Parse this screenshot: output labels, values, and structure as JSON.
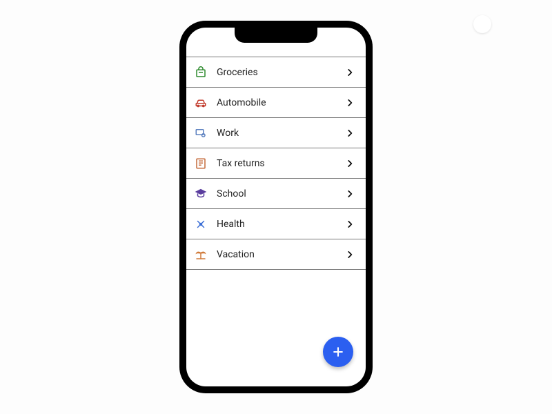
{
  "categories": [
    {
      "id": "groceries",
      "label": "Groceries",
      "icon": "groceries-icon",
      "color": "#2d8a2d"
    },
    {
      "id": "automobile",
      "label": "Automobile",
      "icon": "car-icon",
      "color": "#c23a2b"
    },
    {
      "id": "work",
      "label": "Work",
      "icon": "work-icon",
      "color": "#5a7fbf"
    },
    {
      "id": "tax",
      "label": "Tax returns",
      "icon": "tax-icon",
      "color": "#c46a3a"
    },
    {
      "id": "school",
      "label": "School",
      "icon": "school-icon",
      "color": "#5a3d9e"
    },
    {
      "id": "health",
      "label": "Health",
      "icon": "health-icon",
      "color": "#3c6fd6"
    },
    {
      "id": "vacation",
      "label": "Vacation",
      "icon": "vacation-icon",
      "color": "#d07a3a"
    }
  ],
  "fab": {
    "label": "+"
  },
  "colors": {
    "fab": "#2b5ff0"
  }
}
